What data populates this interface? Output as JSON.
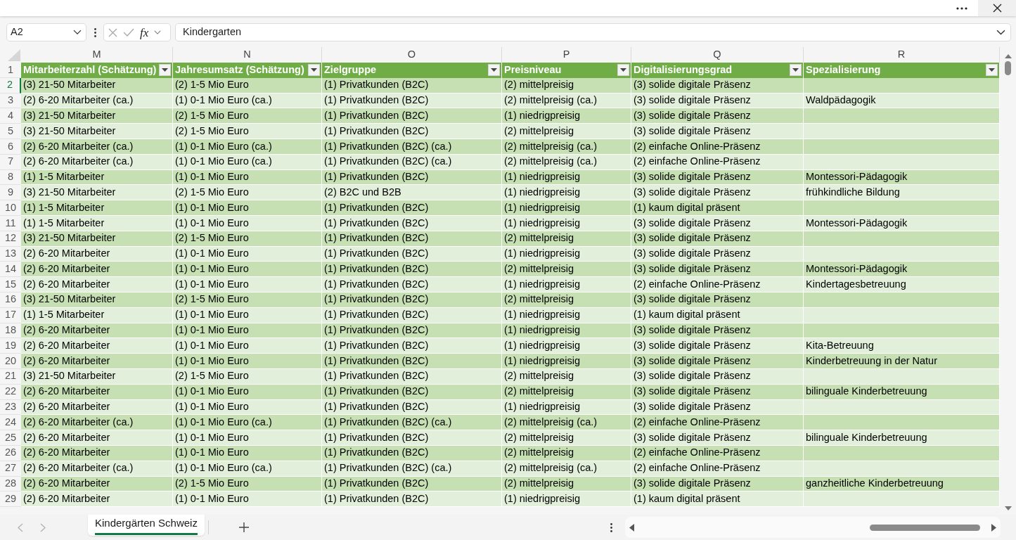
{
  "formula_bar": {
    "name_box": "A2",
    "function_label": "fx",
    "formula": "Kindergarten"
  },
  "columns": [
    {
      "letter": "M",
      "header": "Mitarbeiterzahl (Schätzung)"
    },
    {
      "letter": "N",
      "header": "Jahresumsatz (Schätzung)"
    },
    {
      "letter": "O",
      "header": "Zielgruppe"
    },
    {
      "letter": "P",
      "header": "Preisniveau"
    },
    {
      "letter": "Q",
      "header": "Digitalisierungsgrad"
    },
    {
      "letter": "R",
      "header": "Spezialisierung"
    }
  ],
  "header_row_number": "1",
  "rows": [
    {
      "number": "2",
      "selected": true,
      "cells": [
        "(3) 21-50 Mitarbeiter",
        "(2) 1-5 Mio Euro",
        "(1) Privatkunden (B2C)",
        "(2) mittelpreisig",
        "(3) solide digitale Präsenz"
      ]
    },
    {
      "number": "3",
      "selected": false,
      "cells": [
        "(2) 6-20 Mitarbeiter (ca.)",
        "(1) 0-1 Mio Euro (ca.)",
        "(1) Privatkunden (B2C)",
        "(2) mittelpreisig (ca.)",
        "(3) solide digitale Präsenz",
        "Waldpädagogik"
      ]
    },
    {
      "number": "4",
      "selected": false,
      "cells": [
        "(3) 21-50 Mitarbeiter",
        "(2) 1-5 Mio Euro",
        "(1) Privatkunden (B2C)",
        "(1) niedrigpreisig",
        "(3) solide digitale Präsenz"
      ]
    },
    {
      "number": "5",
      "selected": false,
      "cells": [
        "(3) 21-50 Mitarbeiter",
        "(2) 1-5 Mio Euro",
        "(1) Privatkunden (B2C)",
        "(2) mittelpreisig",
        "(3) solide digitale Präsenz"
      ]
    },
    {
      "number": "6",
      "selected": false,
      "cells": [
        "(2) 6-20 Mitarbeiter (ca.)",
        "(1) 0-1 Mio Euro (ca.)",
        "(1) Privatkunden (B2C) (ca.)",
        "(2) mittelpreisig (ca.)",
        "(2) einfache Online-Präsenz"
      ]
    },
    {
      "number": "7",
      "selected": false,
      "cells": [
        "(2) 6-20 Mitarbeiter (ca.)",
        "(1) 0-1 Mio Euro (ca.)",
        "(1) Privatkunden (B2C) (ca.)",
        "(2) mittelpreisig (ca.)",
        "(2) einfache Online-Präsenz"
      ]
    },
    {
      "number": "8",
      "selected": false,
      "cells": [
        "(1) 1-5 Mitarbeiter",
        "(1) 0-1 Mio Euro",
        "(1) Privatkunden (B2C)",
        "(1) niedrigpreisig",
        "(3) solide digitale Präsenz",
        "Montessori-Pädagogik"
      ]
    },
    {
      "number": "9",
      "selected": false,
      "cells": [
        "(3) 21-50 Mitarbeiter",
        "(2) 1-5 Mio Euro",
        "(2) B2C und B2B",
        "(1) niedrigpreisig",
        "(3) solide digitale Präsenz",
        "frühkindliche Bildung"
      ]
    },
    {
      "number": "10",
      "selected": false,
      "cells": [
        "(1) 1-5 Mitarbeiter",
        "(1) 0-1 Mio Euro",
        "(1) Privatkunden (B2C)",
        "(1) niedrigpreisig",
        "(1) kaum digital präsent"
      ]
    },
    {
      "number": "11",
      "selected": false,
      "cells": [
        "(1) 1-5 Mitarbeiter",
        "(1) 0-1 Mio Euro",
        "(1) Privatkunden (B2C)",
        "(1) niedrigpreisig",
        "(3) solide digitale Präsenz",
        "Montessori-Pädagogik"
      ]
    },
    {
      "number": "12",
      "selected": false,
      "cells": [
        "(3) 21-50 Mitarbeiter",
        "(2) 1-5 Mio Euro",
        "(1) Privatkunden (B2C)",
        "(2) mittelpreisig",
        "(3) solide digitale Präsenz"
      ]
    },
    {
      "number": "13",
      "selected": false,
      "cells": [
        "(2) 6-20 Mitarbeiter",
        "(1) 0-1 Mio Euro",
        "(1) Privatkunden (B2C)",
        "(1) niedrigpreisig",
        "(3) solide digitale Präsenz"
      ]
    },
    {
      "number": "14",
      "selected": false,
      "cells": [
        "(2) 6-20 Mitarbeiter",
        "(1) 0-1 Mio Euro",
        "(1) Privatkunden (B2C)",
        "(2) mittelpreisig",
        "(3) solide digitale Präsenz",
        "Montessori-Pädagogik"
      ]
    },
    {
      "number": "15",
      "selected": false,
      "cells": [
        "(2) 6-20 Mitarbeiter",
        "(1) 0-1 Mio Euro",
        "(1) Privatkunden (B2C)",
        "(1) niedrigpreisig",
        "(2) einfache Online-Präsenz",
        "Kindertagesbetreuung"
      ]
    },
    {
      "number": "16",
      "selected": false,
      "cells": [
        "(3) 21-50 Mitarbeiter",
        "(2) 1-5 Mio Euro",
        "(1) Privatkunden (B2C)",
        "(2) mittelpreisig",
        "(3) solide digitale Präsenz"
      ]
    },
    {
      "number": "17",
      "selected": false,
      "cells": [
        "(1) 1-5 Mitarbeiter",
        "(1) 0-1 Mio Euro",
        "(1) Privatkunden (B2C)",
        "(1) niedrigpreisig",
        "(1) kaum digital präsent"
      ]
    },
    {
      "number": "18",
      "selected": false,
      "cells": [
        "(2) 6-20 Mitarbeiter",
        "(1) 0-1 Mio Euro",
        "(1) Privatkunden (B2C)",
        "(1) niedrigpreisig",
        "(3) solide digitale Präsenz"
      ]
    },
    {
      "number": "19",
      "selected": false,
      "cells": [
        "(2) 6-20 Mitarbeiter",
        "(1) 0-1 Mio Euro",
        "(1) Privatkunden (B2C)",
        "(1) niedrigpreisig",
        "(3) solide digitale Präsenz",
        "Kita-Betreuung"
      ]
    },
    {
      "number": "20",
      "selected": false,
      "cells": [
        "(2) 6-20 Mitarbeiter",
        "(1) 0-1 Mio Euro",
        "(1) Privatkunden (B2C)",
        "(1) niedrigpreisig",
        "(3) solide digitale Präsenz",
        "Kinderbetreuung in der Natur"
      ]
    },
    {
      "number": "21",
      "selected": false,
      "cells": [
        "(3) 21-50 Mitarbeiter",
        "(2) 1-5 Mio Euro",
        "(1) Privatkunden (B2C)",
        "(2) mittelpreisig",
        "(3) solide digitale Präsenz"
      ]
    },
    {
      "number": "22",
      "selected": false,
      "cells": [
        "(2) 6-20 Mitarbeiter",
        "(1) 0-1 Mio Euro",
        "(1) Privatkunden (B2C)",
        "(2) mittelpreisig",
        "(3) solide digitale Präsenz",
        "bilinguale Kinderbetreuung"
      ]
    },
    {
      "number": "23",
      "selected": false,
      "cells": [
        "(2) 6-20 Mitarbeiter",
        "(1) 0-1 Mio Euro",
        "(1) Privatkunden (B2C)",
        "(1) niedrigpreisig",
        "(3) solide digitale Präsenz"
      ]
    },
    {
      "number": "24",
      "selected": false,
      "cells": [
        "(2) 6-20 Mitarbeiter (ca.)",
        "(1) 0-1 Mio Euro (ca.)",
        "(1) Privatkunden (B2C) (ca.)",
        "(2) mittelpreisig (ca.)",
        "(2) einfache Online-Präsenz"
      ]
    },
    {
      "number": "25",
      "selected": false,
      "cells": [
        "(2) 6-20 Mitarbeiter",
        "(1) 0-1 Mio Euro",
        "(1) Privatkunden (B2C)",
        "(2) mittelpreisig",
        "(3) solide digitale Präsenz",
        "bilinguale Kinderbetreuung"
      ]
    },
    {
      "number": "26",
      "selected": false,
      "cells": [
        "(2) 6-20 Mitarbeiter",
        "(1) 0-1 Mio Euro",
        "(1) Privatkunden (B2C)",
        "(2) mittelpreisig",
        "(2) einfache Online-Präsenz"
      ]
    },
    {
      "number": "27",
      "selected": false,
      "cells": [
        "(2) 6-20 Mitarbeiter (ca.)",
        "(1) 0-1 Mio Euro (ca.)",
        "(1) Privatkunden (B2C) (ca.)",
        "(2) mittelpreisig (ca.)",
        "(2) einfache Online-Präsenz"
      ]
    },
    {
      "number": "28",
      "selected": false,
      "cells": [
        "(2) 6-20 Mitarbeiter",
        "(2) 1-5 Mio Euro",
        "(1) Privatkunden (B2C)",
        "(2) mittelpreisig",
        "(3) solide digitale Präsenz",
        "ganzheitliche Kinderbetreuung"
      ]
    },
    {
      "number": "29",
      "selected": false,
      "cells": [
        "(2) 6-20 Mitarbeiter",
        "(1) 0-1 Mio Euro",
        "(1) Privatkunden (B2C)",
        "(1) niedrigpreisig",
        "(1) kaum digital präsent"
      ]
    }
  ],
  "sheet_tabs": [
    {
      "label": "Kindergärten Schweiz",
      "selected": true
    }
  ]
}
